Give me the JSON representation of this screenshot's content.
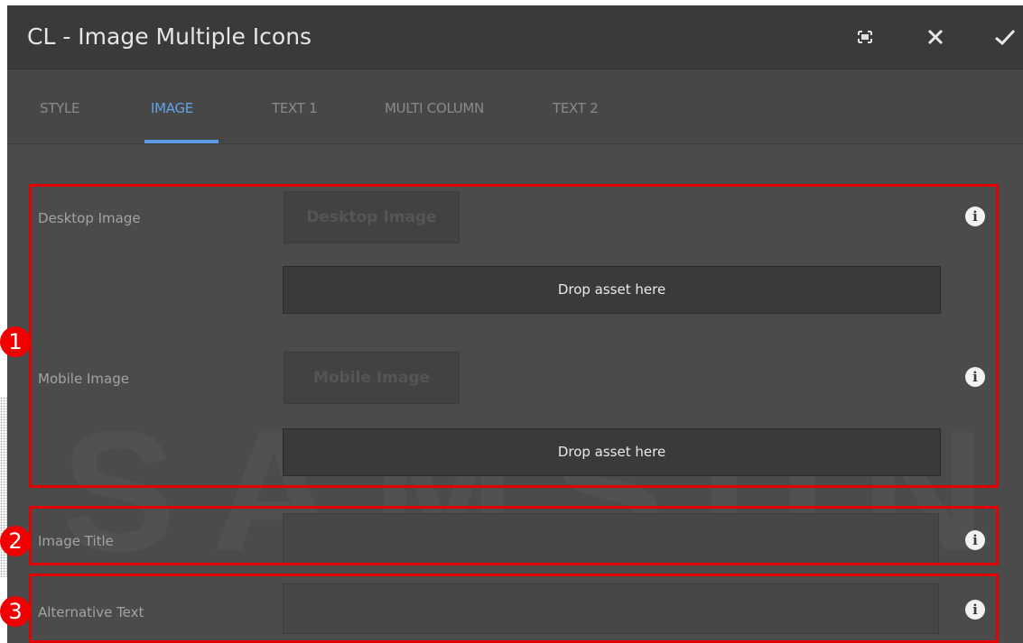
{
  "dialog": {
    "title": "CL - Image Multiple Icons",
    "fullscreen_icon": "fullscreen-icon",
    "close_icon": "close-icon",
    "confirm_icon": "checkmark-icon"
  },
  "tabs": [
    {
      "label": "STYLE"
    },
    {
      "label": "IMAGE"
    },
    {
      "label": "TEXT 1"
    },
    {
      "label": "MULTI COLUMN"
    },
    {
      "label": "TEXT 2"
    }
  ],
  "active_tab": "IMAGE",
  "fields": {
    "desktop_image": {
      "label": "Desktop Image",
      "button": "Desktop Image",
      "drop": "Drop asset here"
    },
    "mobile_image": {
      "label": "Mobile Image",
      "button": "Mobile Image",
      "drop": "Drop asset here"
    },
    "image_title": {
      "label": "Image Title",
      "value": ""
    },
    "alternative_text": {
      "label": "Alternative Text",
      "value": ""
    }
  },
  "info_icon_glyph": "i",
  "markers": [
    "1",
    "2",
    "3"
  ],
  "watermark": "SAMSUNG",
  "colors": {
    "accent": "#63a3e6",
    "annotation": "#e20000"
  }
}
